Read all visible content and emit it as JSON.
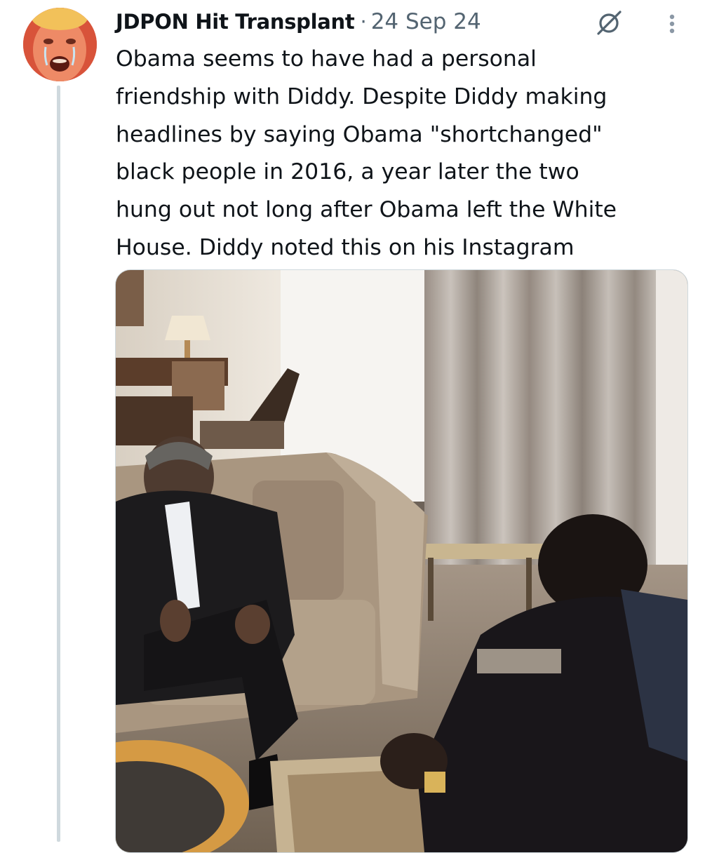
{
  "tweet": {
    "author": {
      "display_name": "JDPON Hit Transplant",
      "avatar_icon": "avatar-icon"
    },
    "separator": "·",
    "timestamp": "24 Sep 24",
    "text_lines": [
      "Obama seems to have had a personal",
      "friendship with Diddy. Despite Diddy making",
      "headlines by saying Obama \"shortchanged\"",
      "black people in 2016, a year later the two",
      "hung out not long after Obama left the White",
      "House. Diddy noted this on his Instagram"
    ],
    "icons": {
      "grok": "grok-icon",
      "more": "more-icon"
    }
  },
  "colors": {
    "text": "#0f1419",
    "secondary": "#536471",
    "thread_line": "#cfd9de",
    "border": "#cfd9de"
  }
}
